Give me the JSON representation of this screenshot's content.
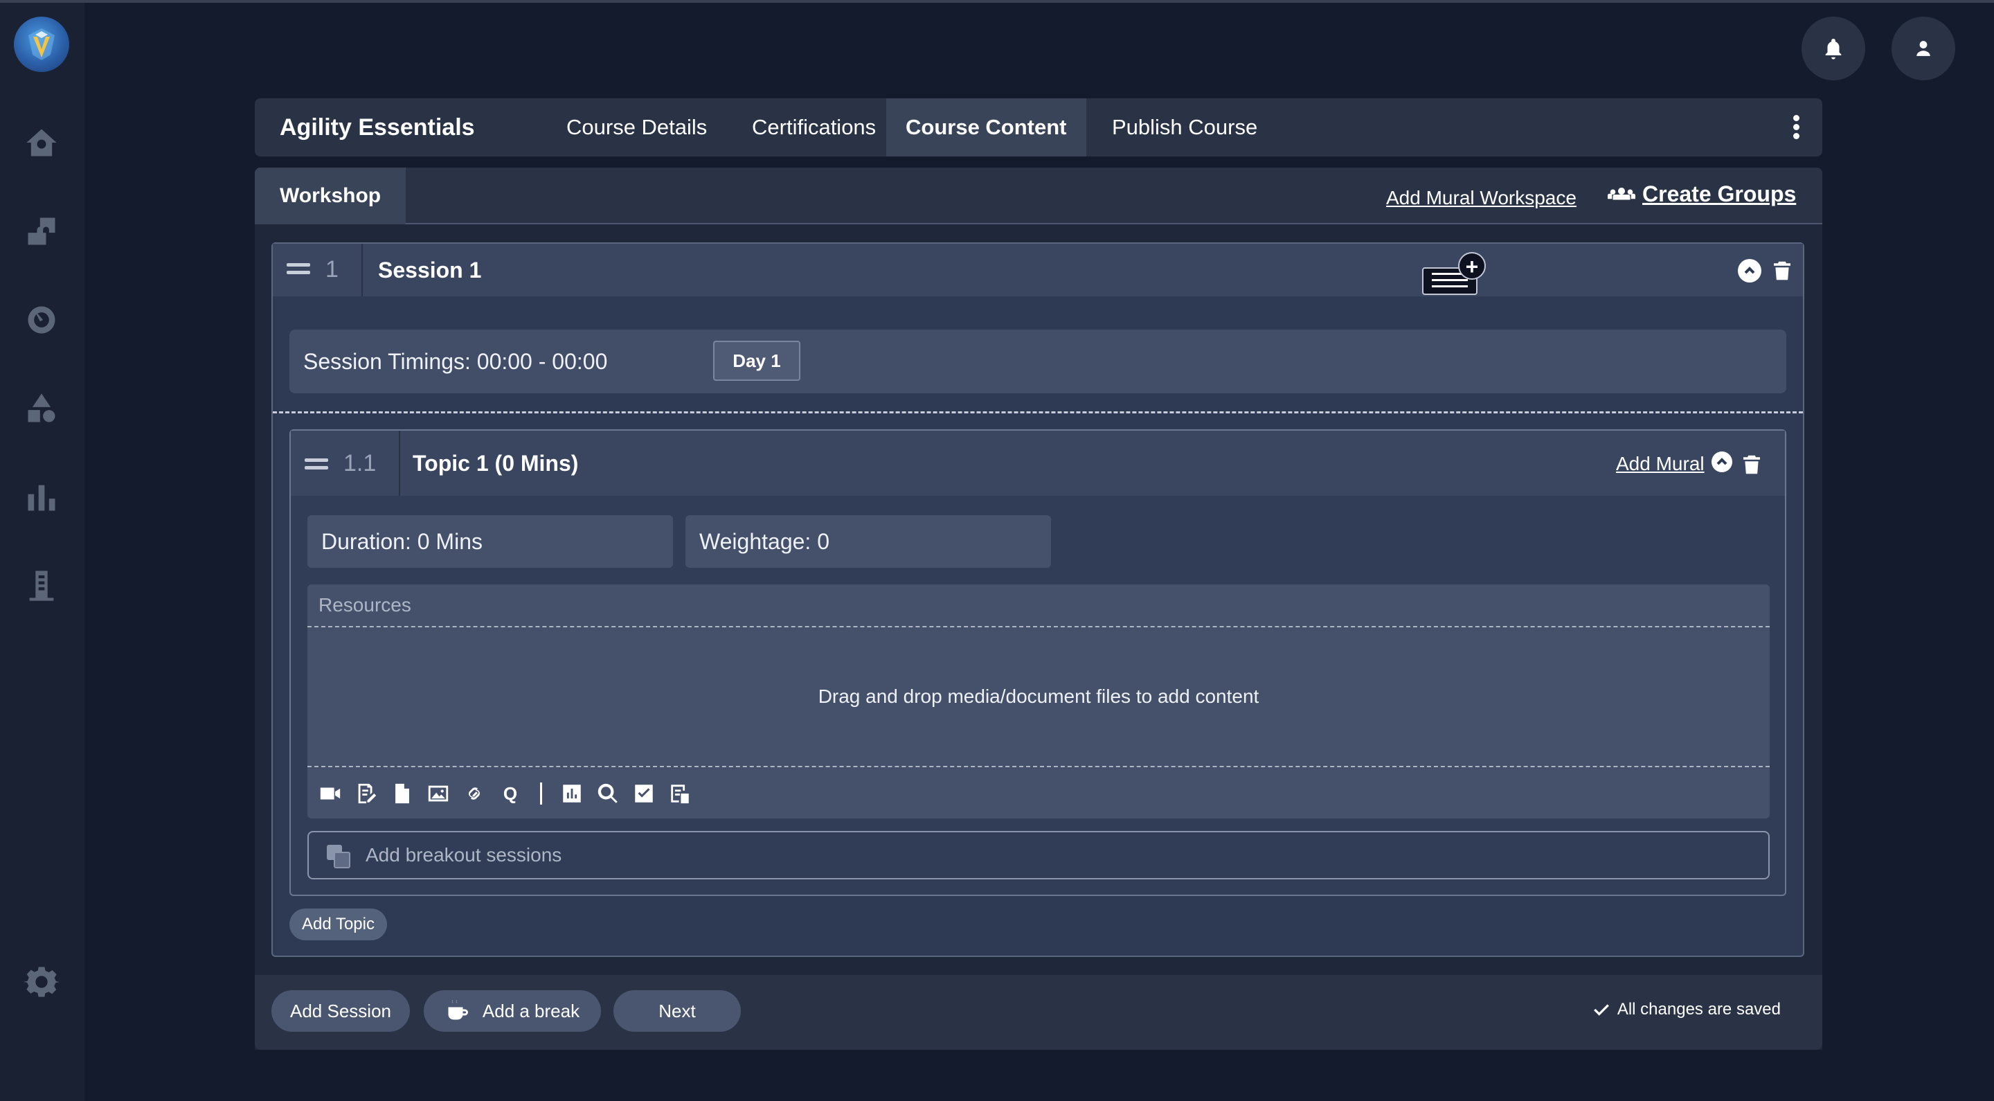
{
  "app": {
    "accent": "#2b5fa8",
    "background": "#141b2d"
  },
  "sidebar": {
    "items": [
      {
        "name": "home",
        "icon": "home-icon"
      },
      {
        "name": "courses",
        "icon": "puzzle-icon"
      },
      {
        "name": "analytics",
        "icon": "gauge-icon"
      },
      {
        "name": "catalog",
        "icon": "shapes-icon"
      },
      {
        "name": "reports",
        "icon": "bar-chart-icon"
      },
      {
        "name": "organization",
        "icon": "building-icon"
      }
    ],
    "settings_icon": "gear-icon"
  },
  "topbar": {
    "notifications_icon": "bell-icon",
    "profile_icon": "user-icon"
  },
  "header": {
    "course_title": "Agility Essentials",
    "tabs": [
      {
        "label": "Course Details",
        "active": false
      },
      {
        "label": "Certifications",
        "active": false
      },
      {
        "label": "Course Content",
        "active": true
      },
      {
        "label": "Publish Course",
        "active": false
      }
    ]
  },
  "workshop": {
    "tab_label": "Workshop",
    "add_mural_workspace": "Add Mural Workspace",
    "create_groups": "Create Groups"
  },
  "session": {
    "number": "1",
    "title": "Session  1",
    "timings_label": "Session Timings: 00:00 - 00:00",
    "day_button": "Day 1",
    "add_note_plus": "+"
  },
  "topic": {
    "number": "1.1",
    "title": "Topic 1 (0 Mins)",
    "add_mural": "Add Mural",
    "duration": "Duration: 0 Mins",
    "weightage": "Weightage: 0",
    "resources_label": "Resources",
    "drop_hint": "Drag and drop media/document files to add content",
    "quiz_glyph": "Q",
    "breakout_placeholder": "Add breakout sessions"
  },
  "actions": {
    "add_topic": "Add Topic",
    "add_session": "Add Session",
    "add_break": "Add a break",
    "next": "Next",
    "saved_status": "All changes are saved"
  }
}
